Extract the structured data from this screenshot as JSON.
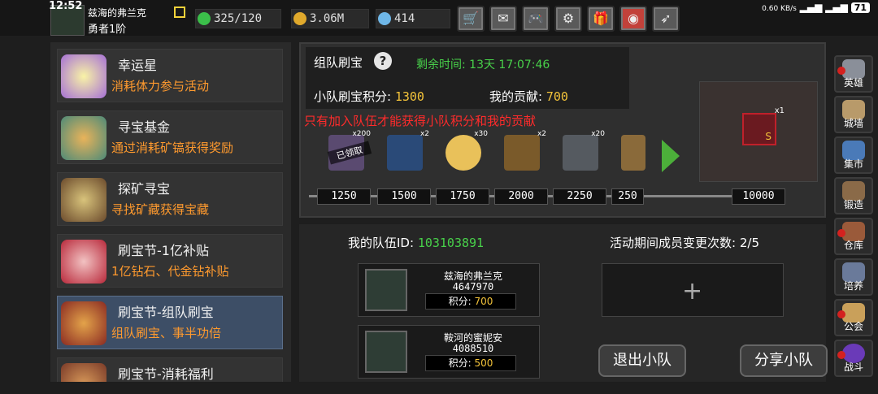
{
  "status": {
    "time": "12:52",
    "net": "0.60 KB/s",
    "battery": "71"
  },
  "player": {
    "name": "兹海的弗兰克",
    "level": "勇者1阶"
  },
  "resources": {
    "stamina": "325/120",
    "gold": "3.06M",
    "diamond": "414"
  },
  "toolbar_icons": [
    "shop-icon",
    "mail-icon",
    "gamepad-icon",
    "gear-icon",
    "gift-icon",
    "wheel-icon",
    "feather-icon"
  ],
  "list": [
    {
      "title": "幸运星",
      "desc": "消耗体力参与活动"
    },
    {
      "title": "寻宝基金",
      "desc": "通过消耗矿镐获得奖励"
    },
    {
      "title": "探矿寻宝",
      "desc": "寻找矿藏获得宝藏"
    },
    {
      "title": "刷宝节-1亿补贴",
      "desc": "1亿钻石、代金钻补贴"
    },
    {
      "title": "刷宝节-组队刷宝",
      "desc": "组队刷宝、事半功倍"
    },
    {
      "title": "刷宝节-消耗福利",
      "desc": ""
    }
  ],
  "event": {
    "title": "组队刷宝",
    "time_left_label": "剩余时间:",
    "time_left": "13天 17:07:46",
    "team_score_label": "小队刷宝积分:",
    "team_score": "1300",
    "my_contrib_label": "我的贡献:",
    "my_contrib": "700",
    "warning": "只有加入队伍才能获得小队积分和我的贡献",
    "claimed_label": "已领取",
    "rewards": [
      {
        "count": "x200",
        "icon": "scroll-icon"
      },
      {
        "count": "x2",
        "icon": "book-icon"
      },
      {
        "count": "x30",
        "icon": "egg-icon"
      },
      {
        "count": "x2",
        "icon": "scroll-icon"
      },
      {
        "count": "x20",
        "icon": "hammer-icon"
      },
      {
        "count": "",
        "icon": "hammer-icon"
      }
    ],
    "milestones": [
      "1250",
      "1500",
      "1750",
      "2000",
      "2250",
      "250",
      "10000"
    ],
    "final_reward_count": "x1",
    "final_reward_letter": "S"
  },
  "team": {
    "id_label": "我的队伍ID:",
    "id": "103103891",
    "changes_label": "活动期间成员变更次数:",
    "changes": "2/5",
    "score_label": "积分:",
    "members": [
      {
        "name": "兹海的弗兰克",
        "uid": "4647970",
        "score": "700"
      },
      {
        "name": "鞍河的蜜妮安",
        "uid": "4088510",
        "score": "500"
      }
    ],
    "invite_symbol": "+",
    "leave_label": "退出小队",
    "share_label": "分享小队"
  },
  "nav": [
    "英雄",
    "城墙",
    "集市",
    "锻造",
    "仓库",
    "培养",
    "公会",
    "战斗"
  ],
  "colors": {
    "accent_green": "#48d14a",
    "gold": "#f3c33a",
    "warn_red": "#ff2b2b",
    "desc_orange": "#ff9a2e"
  }
}
